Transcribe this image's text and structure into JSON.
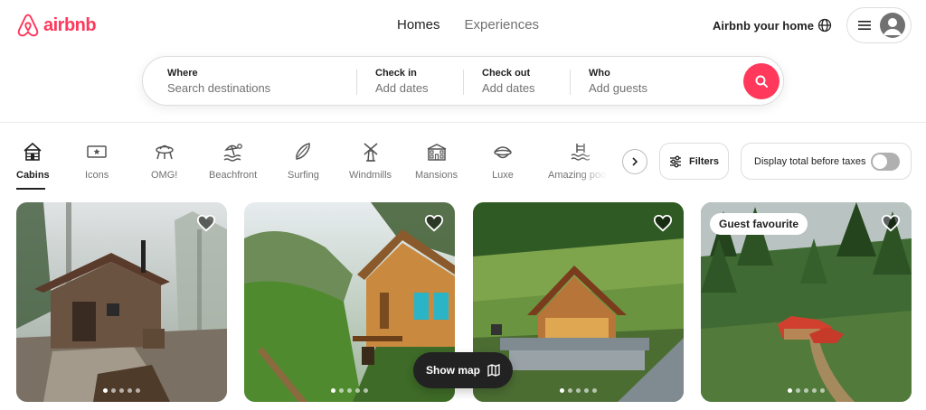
{
  "brand": {
    "name": "airbnb",
    "color": "#ff385c"
  },
  "nav": {
    "tabs": [
      {
        "label": "Homes"
      },
      {
        "label": "Experiences"
      }
    ]
  },
  "header": {
    "host_label": "Airbnb your home",
    "globe_icon": "globe-icon",
    "menu_icon": "hamburger-icon",
    "avatar_icon": "user-avatar-icon"
  },
  "search": {
    "where": {
      "label": "Where",
      "value": "Search destinations"
    },
    "checkin": {
      "label": "Check in",
      "value": "Add dates"
    },
    "checkout": {
      "label": "Check out",
      "value": "Add dates"
    },
    "who": {
      "label": "Who",
      "value": "Add guests"
    },
    "button_icon": "search-icon"
  },
  "categories": [
    {
      "label": "Cabins",
      "icon": "cabin-icon",
      "active": true
    },
    {
      "label": "Icons",
      "icon": "ticket-icon"
    },
    {
      "label": "OMG!",
      "icon": "ufo-house-icon"
    },
    {
      "label": "Beachfront",
      "icon": "beach-icon"
    },
    {
      "label": "Surfing",
      "icon": "surfboard-icon"
    },
    {
      "label": "Windmills",
      "icon": "windmill-icon"
    },
    {
      "label": "Mansions",
      "icon": "mansion-icon"
    },
    {
      "label": "Luxe",
      "icon": "luxe-icon"
    },
    {
      "label": "Amazing pools",
      "icon": "pool-icon"
    }
  ],
  "filters": {
    "label": "Filters",
    "tax_label": "Display total before taxes",
    "tax_toggle_on": false
  },
  "listings": [
    {
      "badge": "",
      "image": "foggy-wooden-cabin",
      "dots": 5,
      "active_dot": 0
    },
    {
      "badge": "",
      "image": "wooden-house-mountain-valley",
      "dots": 5,
      "active_dot": 0
    },
    {
      "badge": "",
      "image": "a-frame-chalet-terraces",
      "dots": 5,
      "active_dot": 0
    },
    {
      "badge": "Guest favourite",
      "image": "red-roof-houses-forest",
      "dots": 5,
      "active_dot": 0
    }
  ],
  "show_map": {
    "label": "Show map",
    "icon": "map-icon"
  }
}
